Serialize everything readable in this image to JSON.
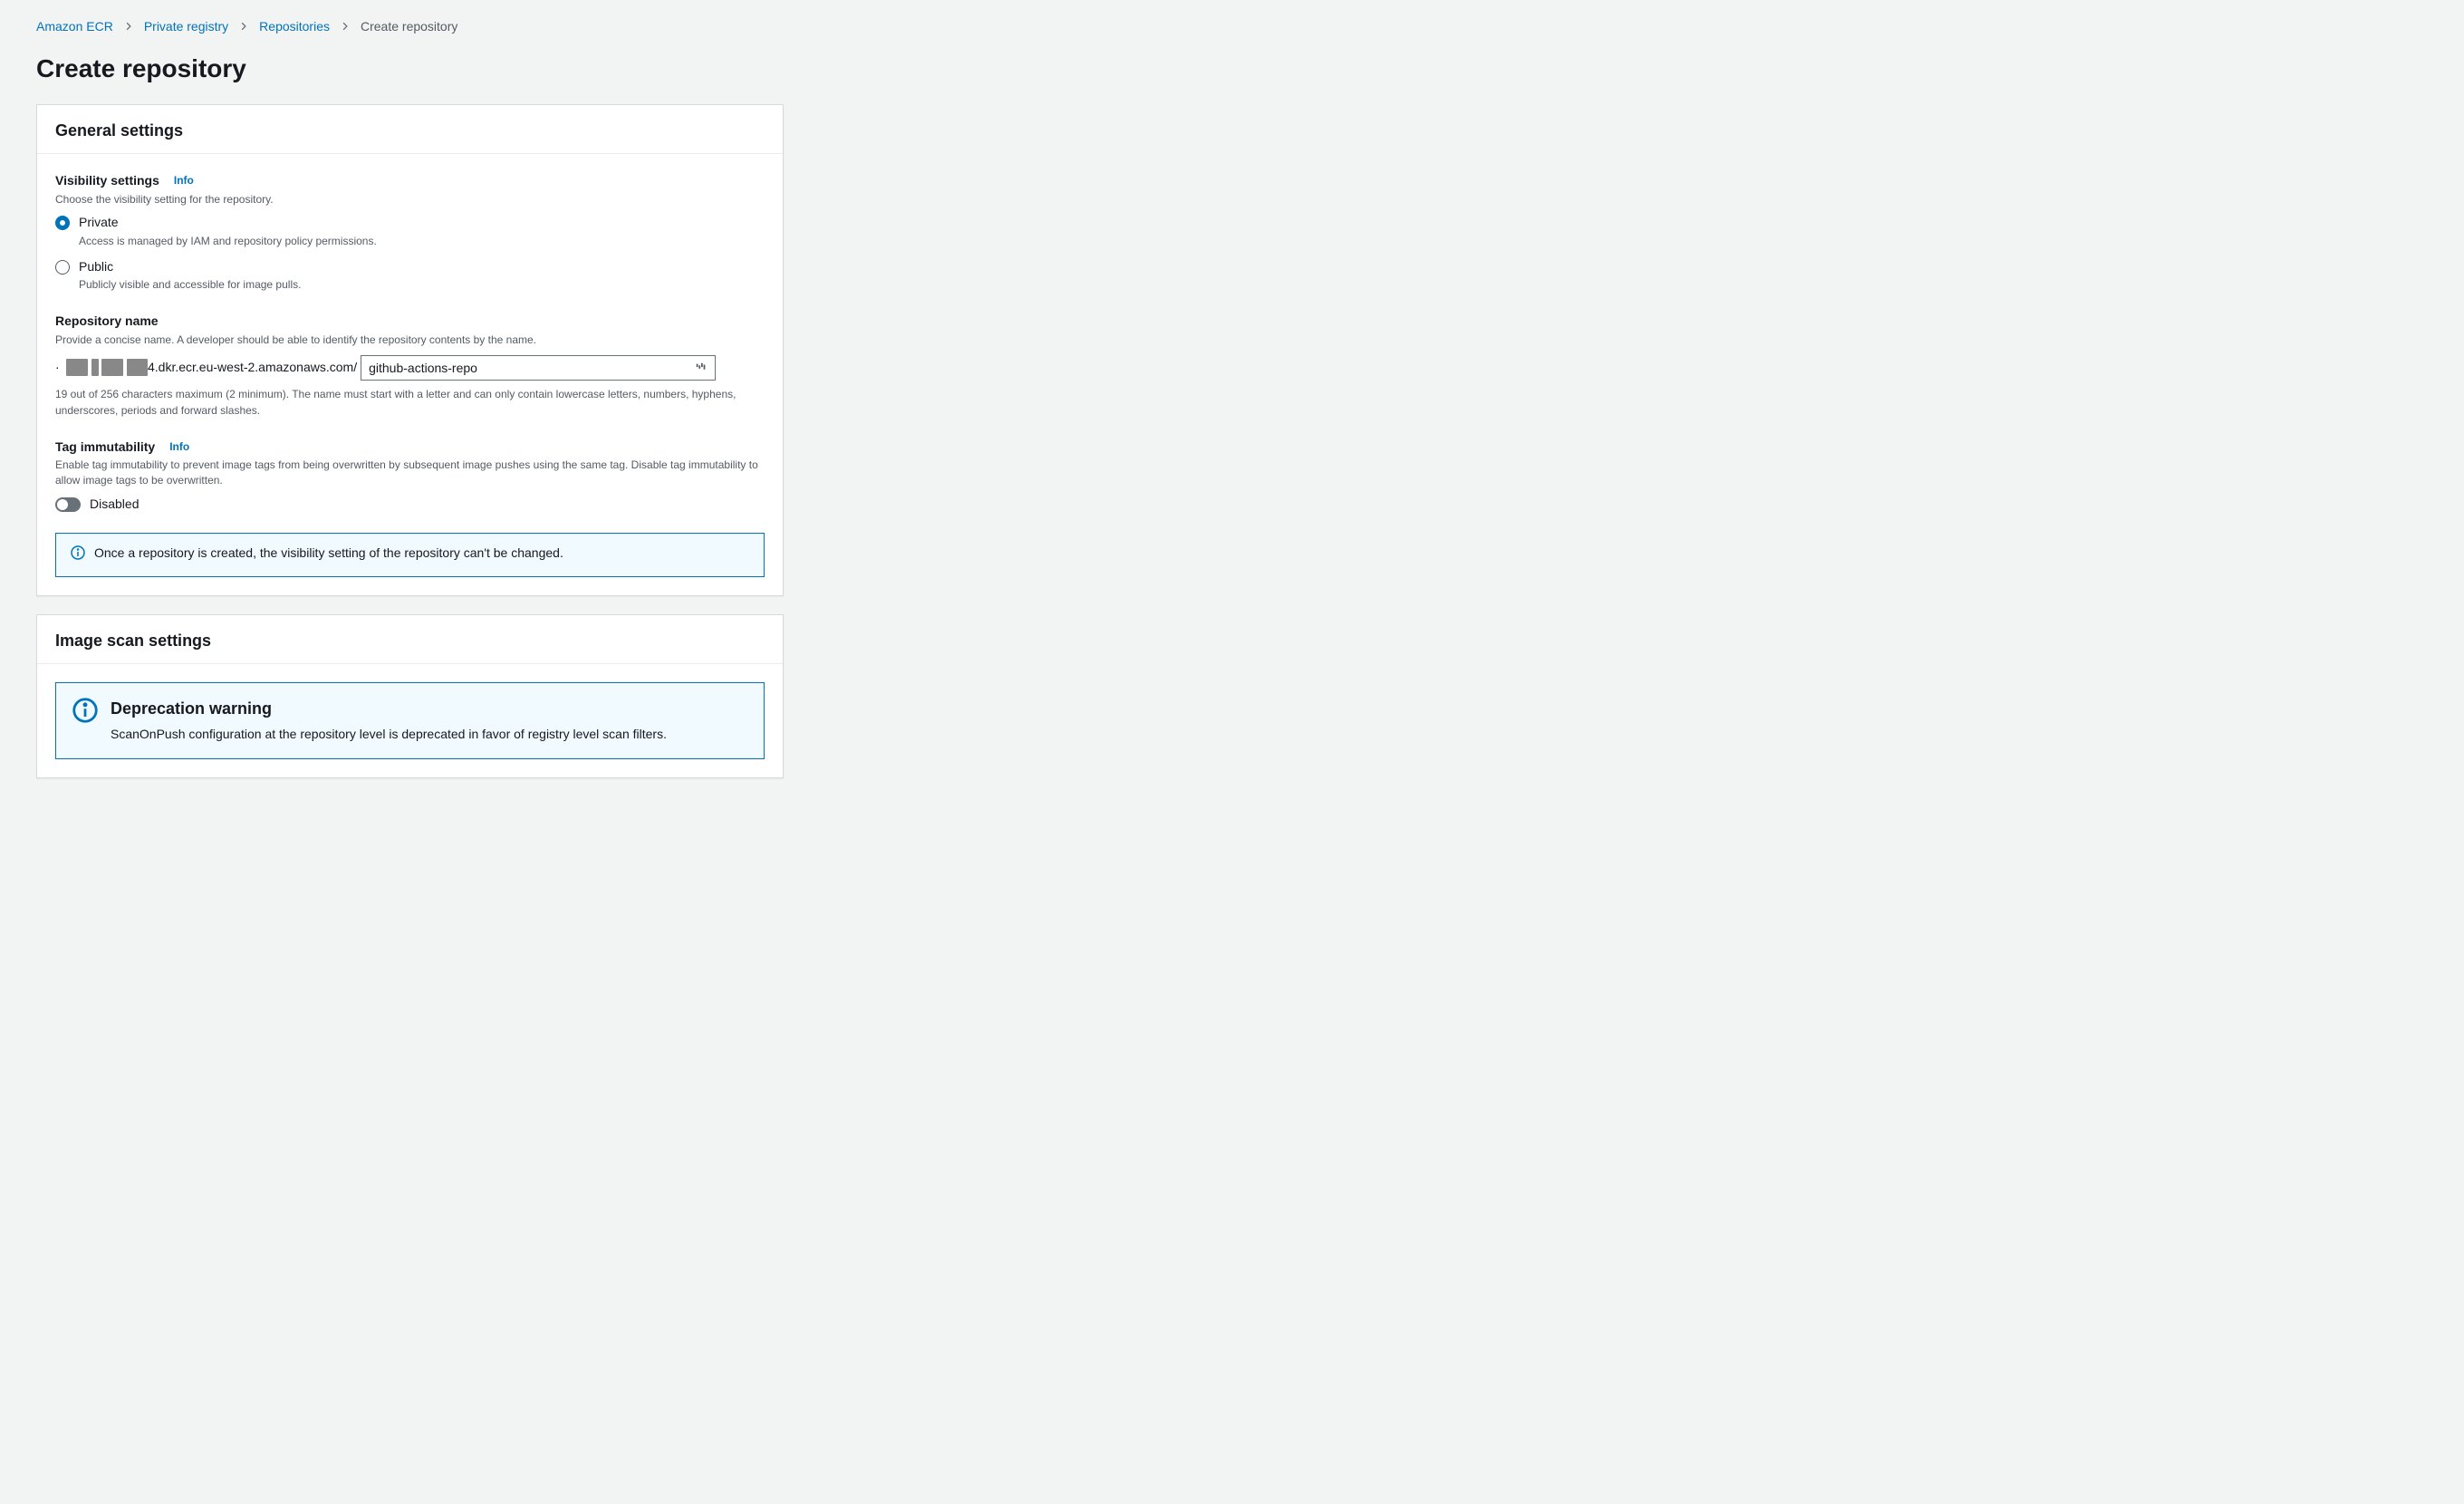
{
  "breadcrumb": {
    "items": [
      {
        "label": "Amazon ECR"
      },
      {
        "label": "Private registry"
      },
      {
        "label": "Repositories"
      }
    ],
    "current": "Create repository"
  },
  "page_title": "Create repository",
  "panel_general": {
    "title": "General settings",
    "visibility": {
      "label": "Visibility settings",
      "info": "Info",
      "desc": "Choose the visibility setting for the repository.",
      "options": [
        {
          "title": "Private",
          "sub": "Access is managed by IAM and repository policy permissions.",
          "checked": true
        },
        {
          "title": "Public",
          "sub": "Publicly visible and accessible for image pulls.",
          "checked": false
        }
      ]
    },
    "repo_name": {
      "label": "Repository name",
      "desc": "Provide a concise name. A developer should be able to identify the repository contents by the name.",
      "prefix_masked": "· ▮▮ ▮ ▮▮ ▮▮",
      "prefix_suffix": "4.dkr.ecr.eu-west-2.amazonaws.com/",
      "value": "github-actions-repo",
      "constraint": "19 out of 256 characters maximum (2 minimum). The name must start with a letter and can only contain lowercase letters, numbers, hyphens, underscores, periods and forward slashes."
    },
    "tag_immutability": {
      "label": "Tag immutability",
      "info": "Info",
      "desc": "Enable tag immutability to prevent image tags from being overwritten by subsequent image pushes using the same tag. Disable tag immutability to allow image tags to be overwritten.",
      "toggle_label": "Disabled"
    },
    "alert": "Once a repository is created, the visibility setting of the repository can't be changed."
  },
  "panel_scan": {
    "title": "Image scan settings",
    "deprecation": {
      "title": "Deprecation warning",
      "desc": "ScanOnPush configuration at the repository level is deprecated in favor of registry level scan filters."
    }
  }
}
